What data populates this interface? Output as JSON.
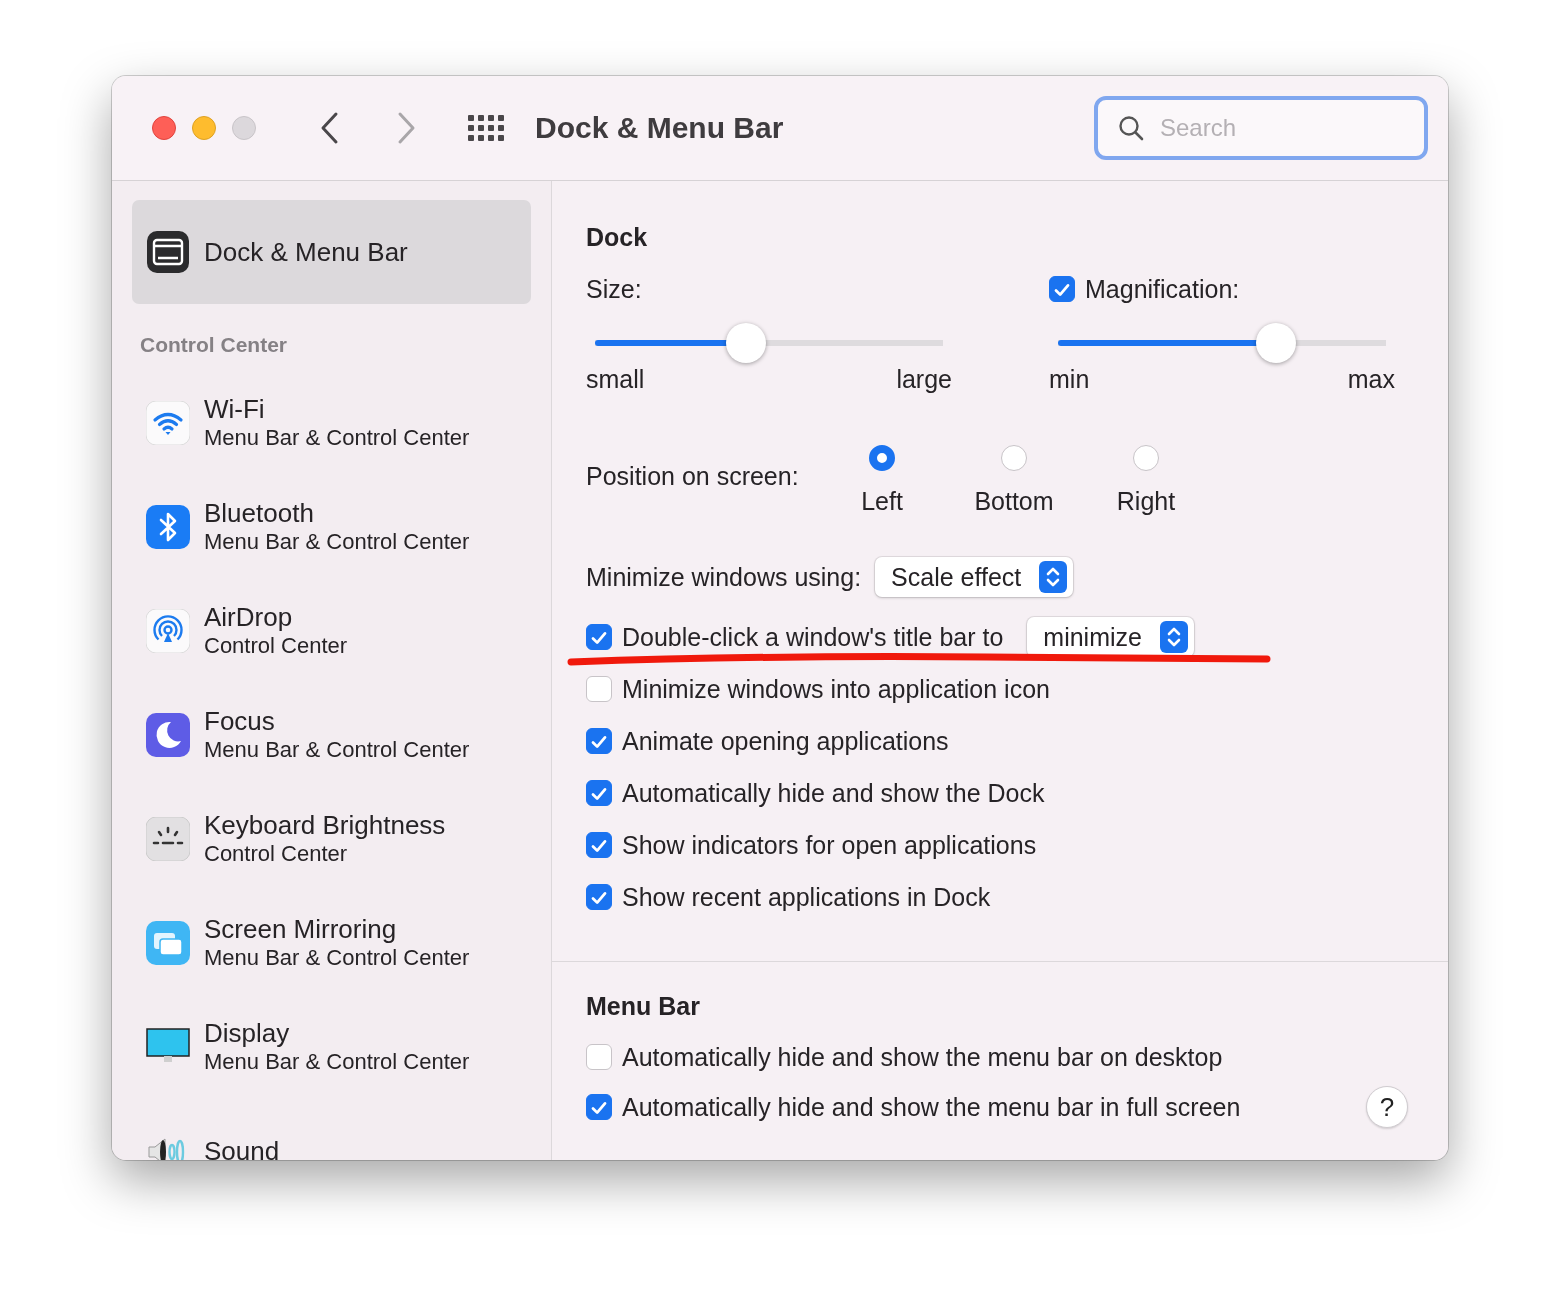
{
  "window": {
    "title": "Dock & Menu Bar"
  },
  "toolbar": {
    "search": {
      "placeholder": "Search"
    }
  },
  "sidebar": {
    "items": [
      {
        "title": "Dock & Menu Bar",
        "selected": true
      }
    ],
    "sections": [
      {
        "header": "Control Center",
        "items": [
          {
            "title": "Wi-Fi",
            "subtitle": "Menu Bar & Control Center",
            "selected": false
          },
          {
            "title": "Bluetooth",
            "subtitle": "Menu Bar & Control Center",
            "selected": false
          },
          {
            "title": "AirDrop",
            "subtitle": "Control Center",
            "selected": false
          },
          {
            "title": "Focus",
            "subtitle": "Menu Bar & Control Center",
            "selected": false
          },
          {
            "title": "Keyboard Brightness",
            "subtitle": "Control Center",
            "selected": false
          },
          {
            "title": "Screen Mirroring",
            "subtitle": "Menu Bar & Control Center",
            "selected": false
          },
          {
            "title": "Display",
            "subtitle": "Menu Bar & Control Center",
            "selected": false
          },
          {
            "title": "Sound",
            "selected": false
          }
        ]
      }
    ]
  },
  "dock": {
    "title": "Dock",
    "sliders": [
      {
        "kind": "plain",
        "label": "Size:",
        "level": 0.435,
        "min_label": "small",
        "max_label": "large"
      },
      {
        "kind": "checkbox",
        "label": "Magnification:",
        "checked": true,
        "level": 0.664,
        "min_label": "min",
        "max_label": "max"
      }
    ],
    "position": {
      "label": "Position on screen:",
      "options": [
        {
          "label": "Left",
          "selected": true
        },
        {
          "label": "Bottom",
          "selected": false
        },
        {
          "label": "Right",
          "selected": false
        }
      ]
    },
    "minimize_using": {
      "label": "Minimize windows using:",
      "value": "Scale effect"
    },
    "options": [
      {
        "label": "Double-click a window's title bar to",
        "checked": true,
        "popup": "minimize"
      },
      {
        "label": "Minimize windows into application icon",
        "checked": false
      },
      {
        "label": "Animate opening applications",
        "checked": true
      },
      {
        "label": "Automatically hide and show the Dock",
        "checked": true
      },
      {
        "label": "Show indicators for open applications",
        "checked": true
      },
      {
        "label": "Show recent applications in Dock",
        "checked": true
      }
    ]
  },
  "menu_bar": {
    "title": "Menu Bar",
    "options": [
      {
        "label": "Automatically hide and show the menu bar on desktop",
        "checked": false
      },
      {
        "label": "Automatically hide and show the menu bar in full screen",
        "checked": true
      }
    ]
  },
  "help": {
    "label": "?"
  }
}
